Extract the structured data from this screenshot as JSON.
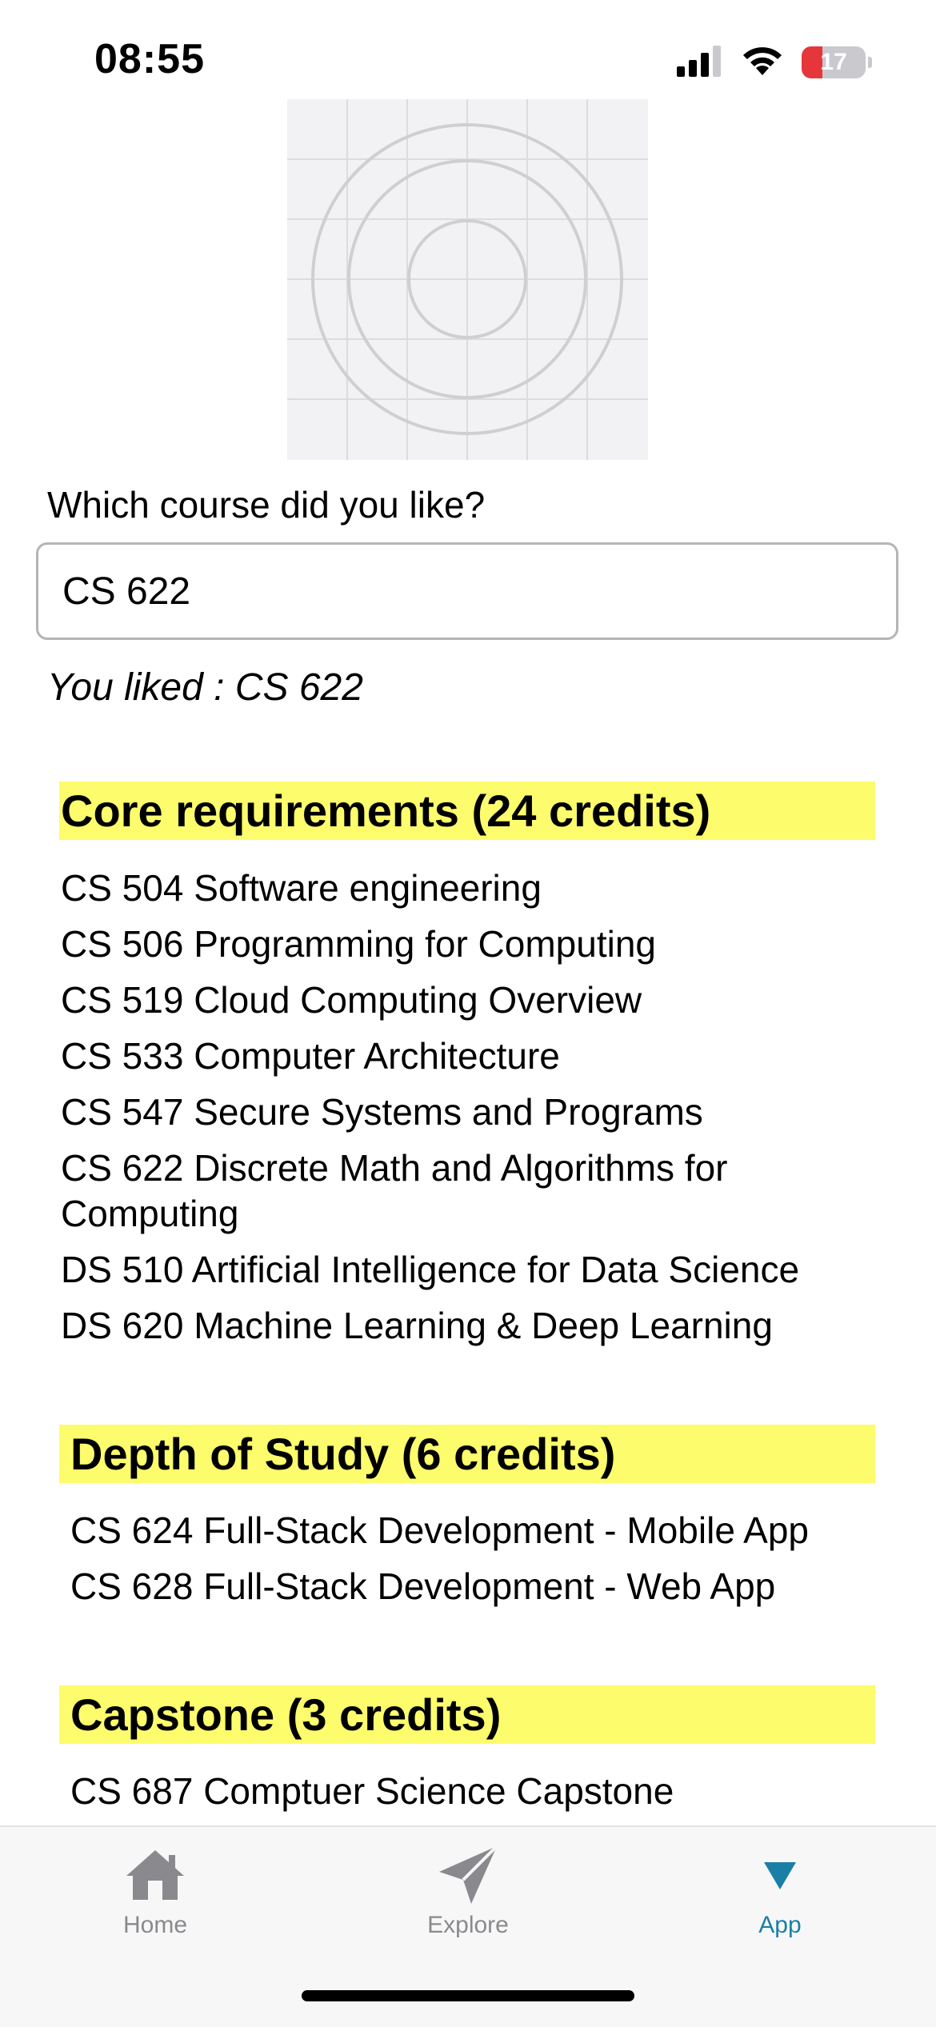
{
  "status_bar": {
    "time": "08:55",
    "battery_level": "17",
    "battery_fraction": 0.17
  },
  "hero": {
    "icon": "image-placeholder-icon"
  },
  "form": {
    "prompt": "Which course did you like?",
    "input_value": "CS 622",
    "result_text": "You liked : CS 622"
  },
  "sections": [
    {
      "heading": "Core requirements (24 credits)",
      "courses": [
        "CS 504 Software engineering",
        "CS 506 Programming for Computing",
        "CS 519 Cloud Computing Overview",
        "CS 533 Computer Architecture",
        "CS 547 Secure Systems and Programs",
        "CS 622 Discrete Math and Algorithms for",
        "Computing",
        "DS 510 Artificial Intelligence for Data Science",
        "DS 620 Machine Learning & Deep Learning"
      ]
    },
    {
      "heading": "Depth of Study (6 credits)",
      "courses": [
        "CS 624 Full-Stack Development - Mobile App",
        "CS 628 Full-Stack Development - Web App"
      ]
    },
    {
      "heading": "Capstone (3 credits)",
      "courses": [
        "CS 687 Comptuer Science Capstone"
      ]
    }
  ],
  "tab_bar": {
    "tabs": [
      {
        "label": "Home",
        "icon": "home-icon"
      },
      {
        "label": "Explore",
        "icon": "paper-plane-icon"
      },
      {
        "label": "App",
        "icon": "triangle-down-icon"
      }
    ],
    "active_index": 2,
    "active_color": "#1a7fa6",
    "inactive_color": "#8a8a8e"
  },
  "colors": {
    "section_highlight": "#fdfc6c",
    "battery_low": "#e5373a"
  }
}
